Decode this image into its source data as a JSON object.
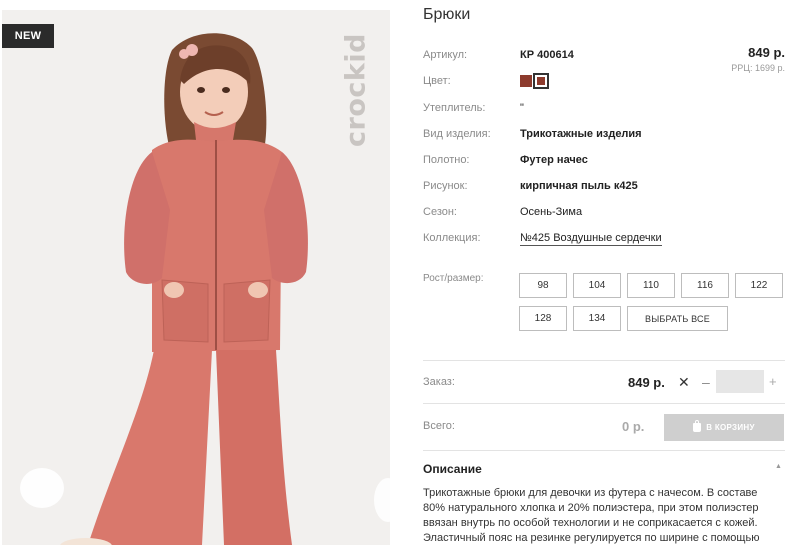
{
  "badge": "NEW",
  "brand": "crockid",
  "product": {
    "title": "Брюки",
    "price": "849 р.",
    "rrp": "РРЦ: 1699 р."
  },
  "props": {
    "article_label": "Артикул:",
    "article_value": "КР 400614",
    "color_label": "Цвет:",
    "insulation_label": "Утеплитель:",
    "insulation_value": "\"",
    "type_label": "Вид изделия:",
    "type_value": "Трикотажные изделия",
    "fabric_label": "Полотно:",
    "fabric_value": "Футер начес",
    "pattern_label": "Рисунок:",
    "pattern_value": "кирпичная пыль к425",
    "season_label": "Сезон:",
    "season_value": "Осень-Зима",
    "collection_label": "Коллекция:",
    "collection_value": "№425 Воздушные сердечки"
  },
  "colors": [
    "#8d3b2d",
    "#8d3b2d"
  ],
  "sizes": {
    "label": "Рост/размер:",
    "options": [
      "98",
      "104",
      "110",
      "116",
      "122",
      "128",
      "134"
    ],
    "select_all": "ВЫБРАТЬ ВСЕ"
  },
  "order": {
    "label": "Заказ:",
    "price": "849 р.",
    "times": "✕",
    "minus": "–",
    "plus": "+",
    "qty": ""
  },
  "total": {
    "label": "Всего:",
    "value": "0 р.",
    "cart_button": "В КОРЗИНУ"
  },
  "description": {
    "title": "Описание",
    "toggle": "▲",
    "text": "Трикотажные брюки для девочки из футера с начесом. В составе 80% натурального хлопка и 20% полиэстера, при этом полиэстер ввязан внутрь по особой технологии и не соприкасается с кожей. Эластичный пояс на резинке регулируется по ширине с помощью"
  }
}
